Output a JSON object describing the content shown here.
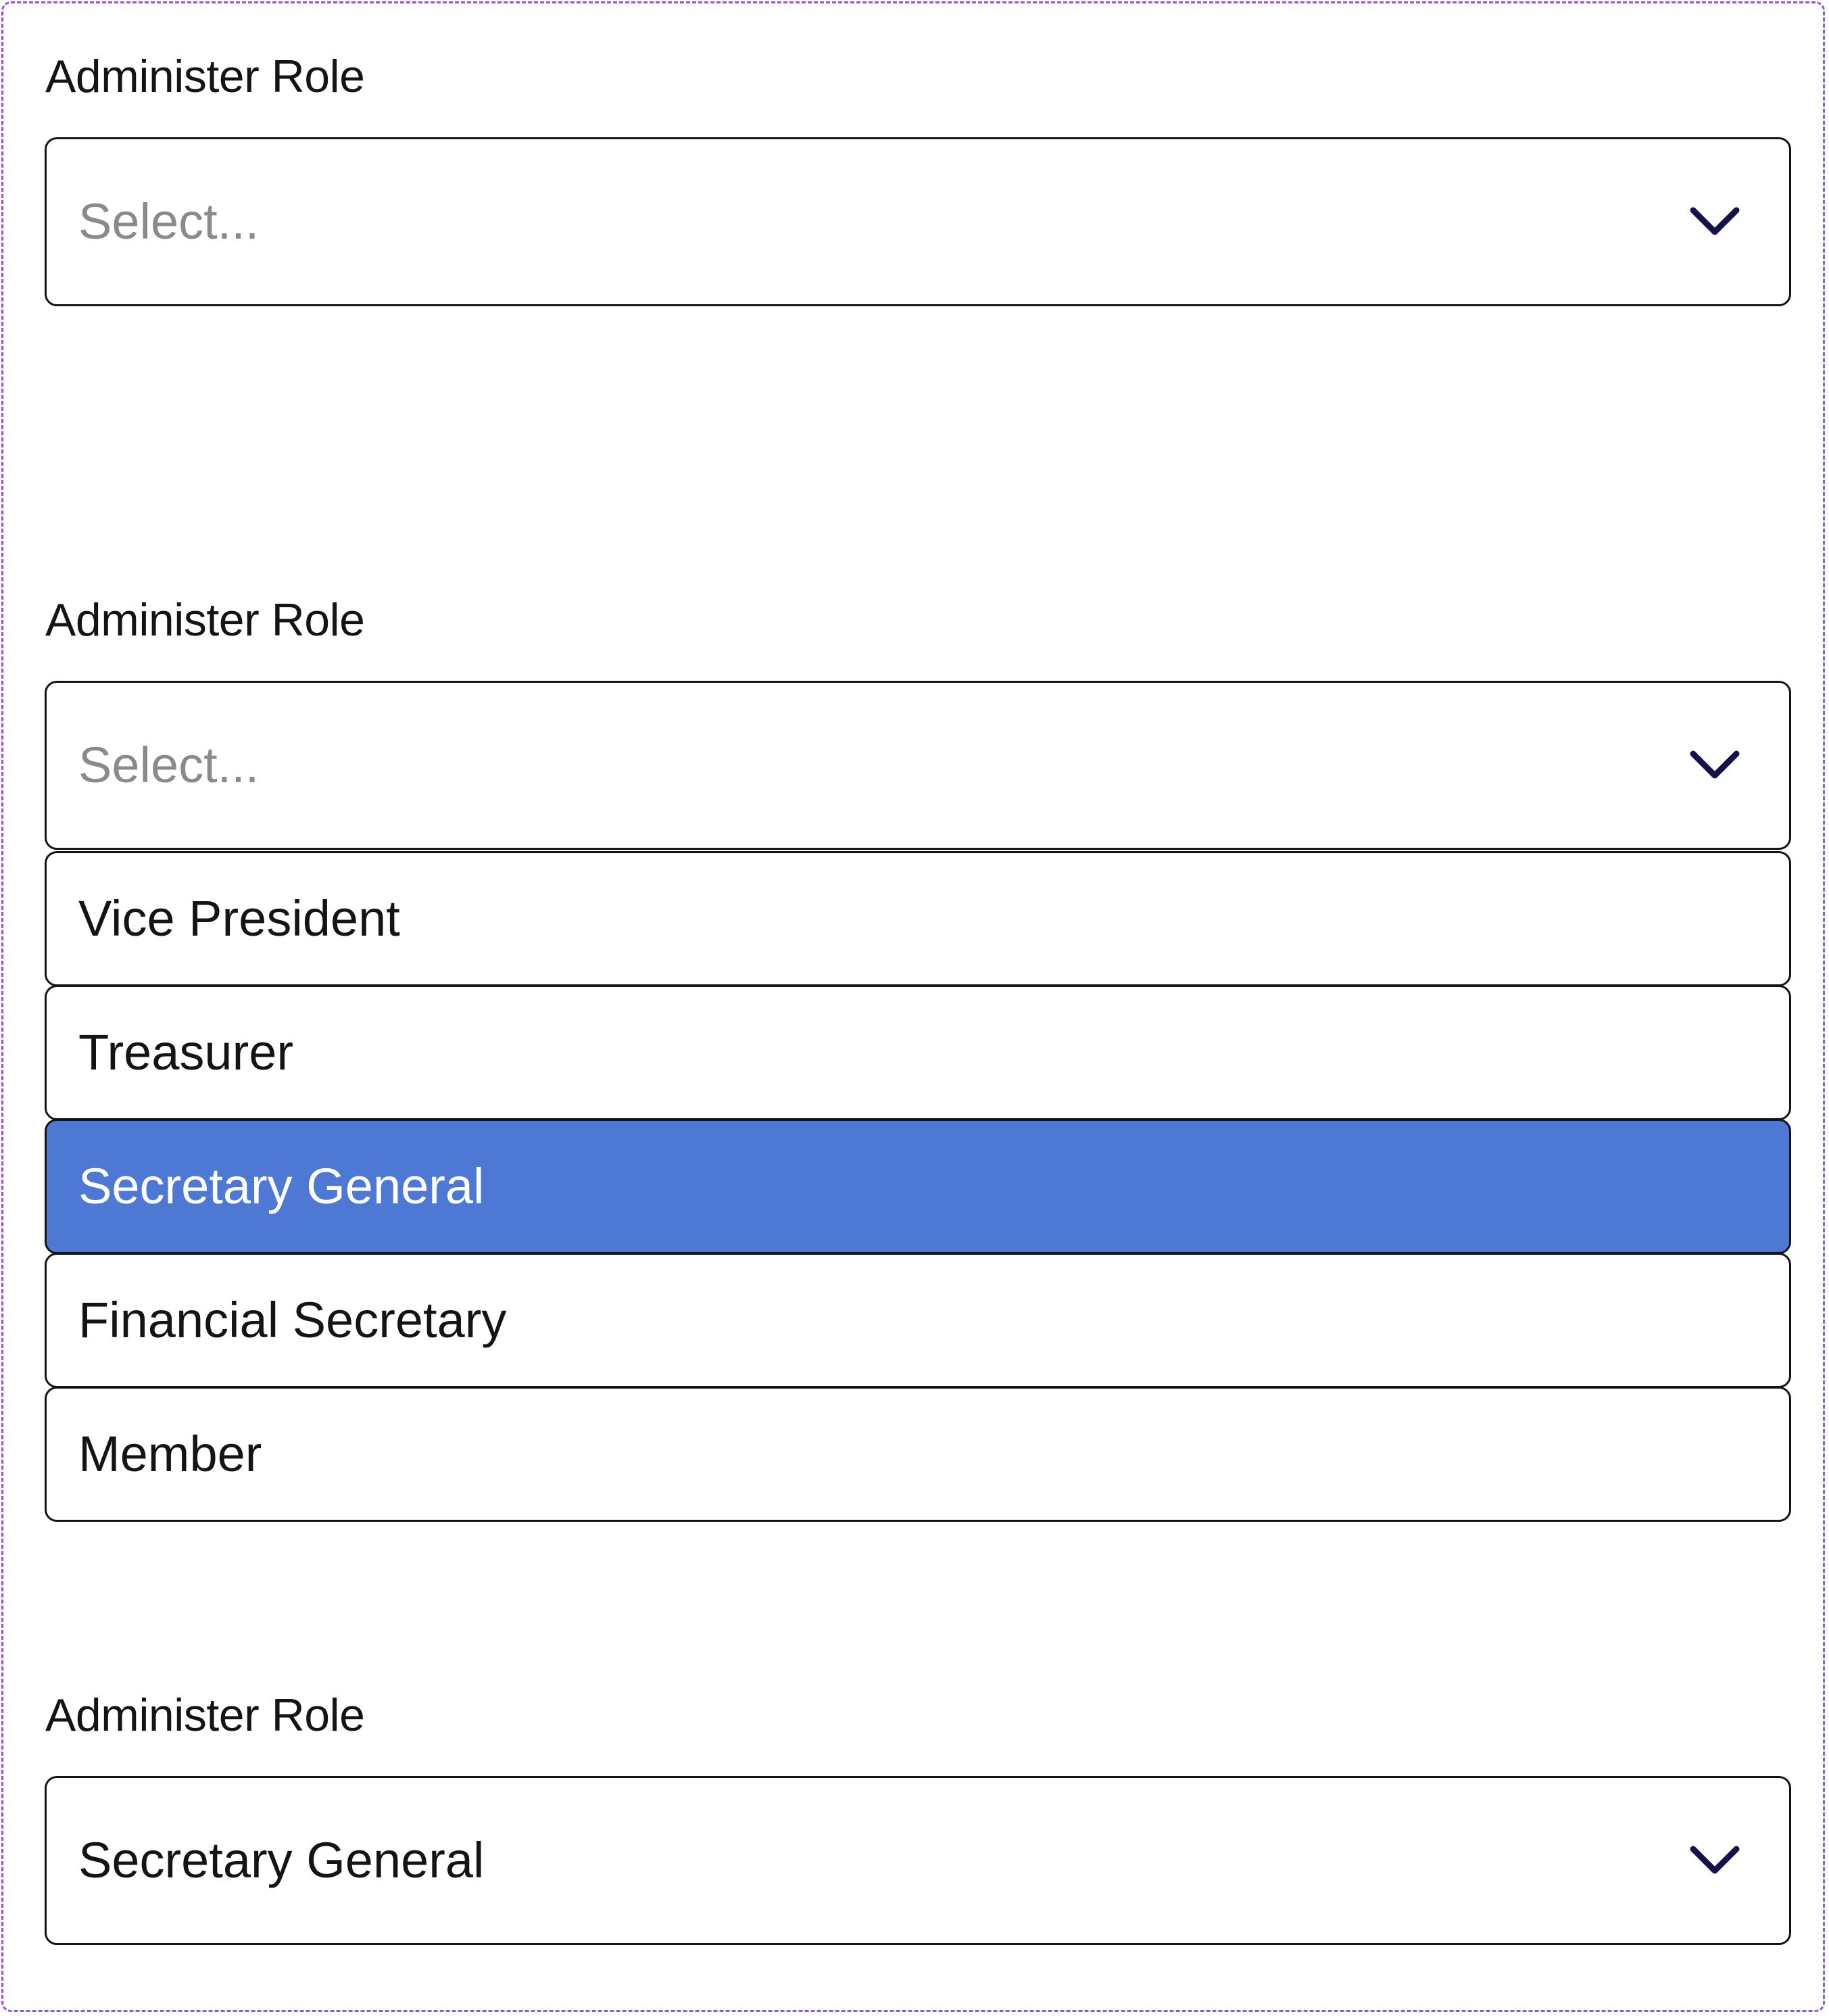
{
  "colors": {
    "frame_border": "#9b51e0",
    "selected_option_bg": "#4d79d5",
    "selected_option_text": "#ffffff",
    "chevron": "#14124a",
    "placeholder_text": "#8a8a8a",
    "text": "#141414"
  },
  "icons": {
    "dropdown": "chevron-down-icon"
  },
  "fields": [
    {
      "state": "closed-empty",
      "label": "Administer Role",
      "placeholder": "Select..."
    },
    {
      "state": "open",
      "label": "Administer Role",
      "placeholder": "Select...",
      "options": [
        {
          "label": "Vice President",
          "highlighted": false
        },
        {
          "label": "Treasurer",
          "highlighted": false
        },
        {
          "label": "Secretary General",
          "highlighted": true
        },
        {
          "label": "Financial Secretary",
          "highlighted": false
        },
        {
          "label": "Member",
          "highlighted": false
        }
      ]
    },
    {
      "state": "closed-selected",
      "label": "Administer Role",
      "value": "Secretary General"
    }
  ]
}
